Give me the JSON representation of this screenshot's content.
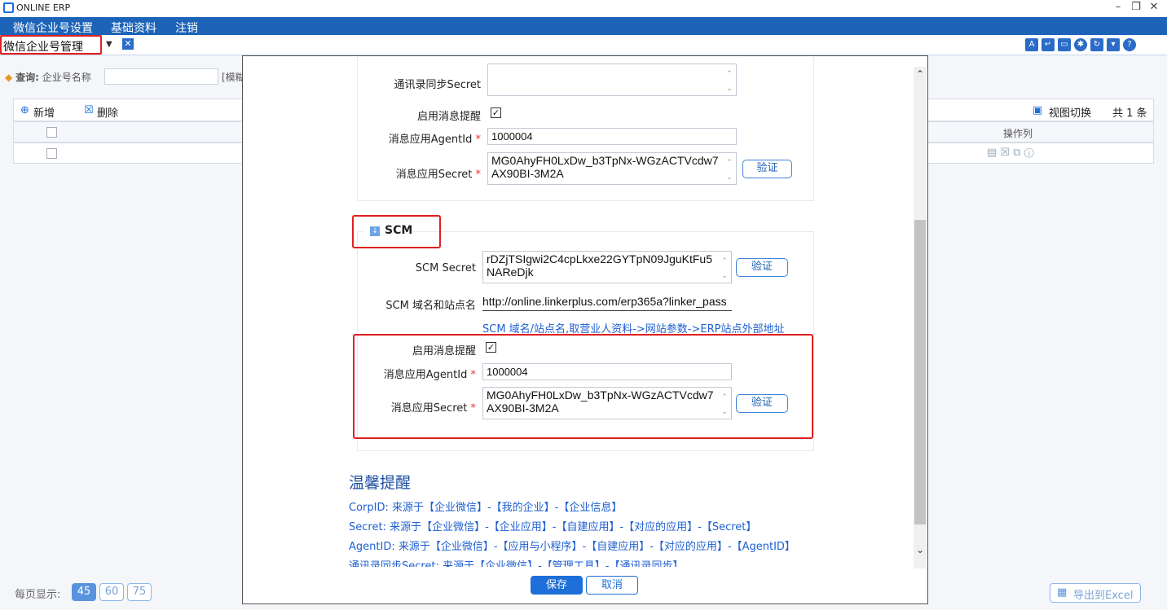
{
  "app": {
    "title": "ONLINE ERP"
  },
  "menu": [
    "微信企业号设置",
    "基础资料",
    "注销"
  ],
  "tab": {
    "active_label": "微信企业号管理"
  },
  "query": {
    "label": "查询:",
    "field_label": "企业号名称",
    "hint": "[模糊"
  },
  "toolbar": {
    "add": "新增",
    "delete": "删除",
    "view_switch": "视图切换",
    "count": "共 1 条"
  },
  "grid": {
    "ops_header": "操作列"
  },
  "footer": {
    "per_page_label": "每页显示:",
    "page_sizes": [
      "45",
      "60",
      "75"
    ],
    "export": "导出到Excel"
  },
  "form": {
    "contacts_secret_label": "通讯录同步Secret",
    "contacts_secret_value": "",
    "enable_msg_label_1": "启用消息提醒",
    "agentid_label_1": "消息应用AgentId",
    "agentid_value_1": "1000004",
    "msg_secret_label_1": "消息应用Secret",
    "msg_secret_value_1": "MG0AhyFH0LxDw_b3TpNx-WGzACTVcdw7AX90BI-3M2A",
    "verify_1": "验证",
    "scm_legend": "SCM",
    "scm_secret_label": "SCM Secret",
    "scm_secret_value": "rDZjTSIgwi2C4cpLkxe22GYTpN09JguKtFu5NAReDjk",
    "verify_scm": "验证",
    "scm_domain_label": "SCM 域名和站点名",
    "scm_domain_value": "http://online.linkerplus.com/erp365a?linker_pass",
    "scm_domain_hint": "SCM 域名/站点名,取营业人资料->网站参数->ERP站点外部地址",
    "enable_msg_label_2": "启用消息提醒",
    "agentid_label_2": "消息应用AgentId",
    "agentid_value_2": "1000004",
    "msg_secret_label_2": "消息应用Secret",
    "msg_secret_value_2": "MG0AhyFH0LxDw_b3TpNx-WGzACTVcdw7AX90BI-3M2A",
    "verify_2": "验证"
  },
  "tips": {
    "title": "温馨提醒",
    "lines": [
      "CorpID: 来源于【企业微信】-【我的企业】-【企业信息】",
      "Secret: 来源于【企业微信】-【企业应用】-【自建应用】-【对应的应用】-【Secret】",
      "AgentID: 来源于【企业微信】-【应用与小程序】-【自建应用】-【对应的应用】-【AgentID】",
      "通讯录同步Secret: 来源于【企业微信】-【管理工具】-【通讯录同步】"
    ]
  },
  "dialog": {
    "save": "保存",
    "cancel": "取消"
  },
  "colors": {
    "accent": "#1e6fd9",
    "menu_bg": "#1d64b8",
    "highlight": "#e02020"
  }
}
